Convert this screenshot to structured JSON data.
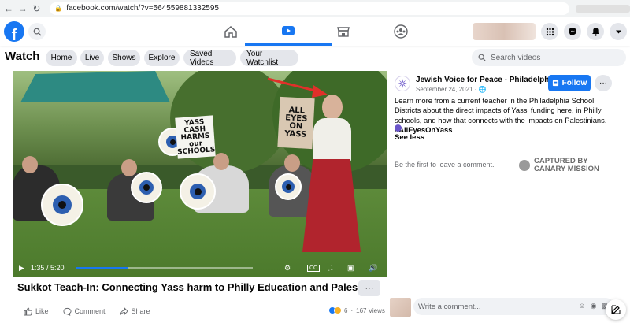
{
  "browser": {
    "url": "facebook.com/watch/?v=564559881332595"
  },
  "colors": {
    "brand": "#1877f2",
    "pill_bg": "#e4e6eb",
    "muted": "#65676b"
  },
  "topnav": {
    "logo": "f",
    "icons": [
      "home-icon",
      "watch-icon",
      "marketplace-icon",
      "groups-icon"
    ],
    "right_icons": [
      "apps-grid-icon",
      "messenger-icon",
      "notifications-bell-icon",
      "account-chevron-icon"
    ]
  },
  "watch": {
    "title": "Watch",
    "tabs": [
      "Home",
      "Live",
      "Shows",
      "Explore",
      "Saved Videos",
      "Your Watchlist"
    ],
    "search_placeholder": "Search videos"
  },
  "video": {
    "current_time": "1:35",
    "duration": "5:20",
    "time_display": "1:35 / 5:20",
    "progress": 0.297,
    "signs": [
      "YASS CASH HARMS our SCHOOLS",
      "ALL EYES ON YASS"
    ],
    "controls": [
      "play-icon",
      "settings-icon",
      "captions-icon",
      "fullscreen-icon",
      "pip-icon",
      "volume-icon"
    ]
  },
  "post": {
    "title": "Sukkot Teach-In: Connecting Yass harm to Philly Education and Palestine",
    "more_label": "···",
    "actions": {
      "like": "Like",
      "comment": "Comment",
      "share": "Share"
    },
    "reaction_count": "6",
    "views": "167 Views"
  },
  "sidebar": {
    "page_name": "Jewish Voice for Peace - Philadelphia",
    "date": "September 24, 2021 · ",
    "follow_label": "Follow",
    "description": "Learn more from a current teacher in the Philadelphia School Districts about the direct impacts of Yass' funding here, in Philly schools, and how that connects with the impacts on Palestinians. ",
    "hashtag": "#AllEyesOnYass",
    "see_less": "See less",
    "first_comment": "Be the first to leave a comment.",
    "watermark_line1": "CAPTURED BY",
    "watermark_line2": "CANARY MISSION",
    "comment_placeholder": "Write a comment..."
  }
}
